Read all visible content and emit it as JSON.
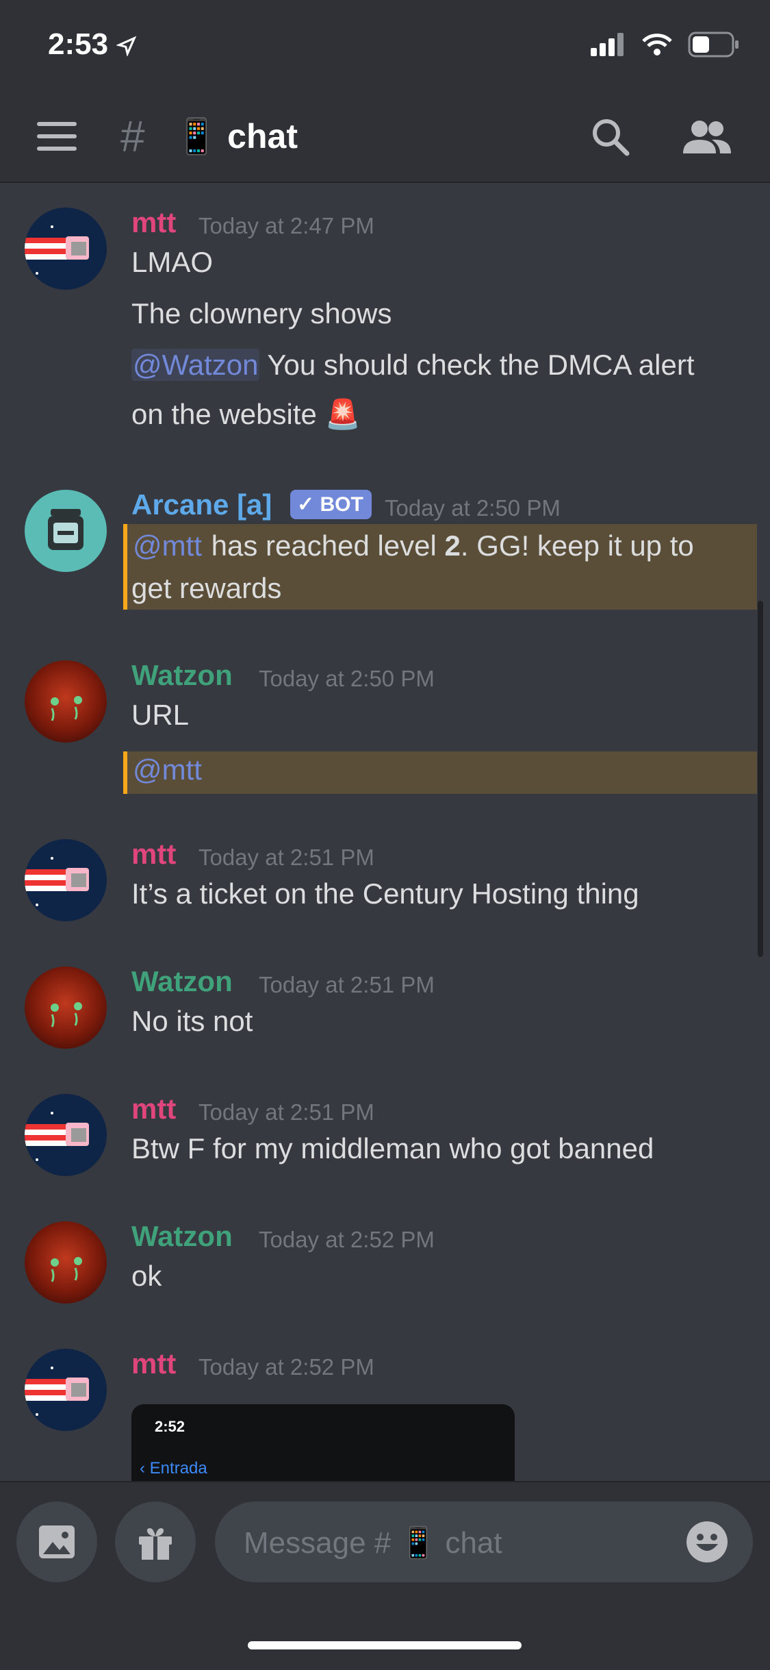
{
  "status": {
    "time": "2:53"
  },
  "header": {
    "hash": "#",
    "channel_emoji": "📱",
    "channel_name": "chat"
  },
  "messages": [
    {
      "user": "mtt",
      "time": "Today at 2:47 PM",
      "lines": [
        "LMAO",
        "The clownery shows"
      ],
      "mention": "@Watzon",
      "mention_rest": " You should check the DMCA alert",
      "wrap": "on the website 🚨"
    },
    {
      "user": "Arcane [a]",
      "bot_label": "BOT",
      "time": "Today at 2:50 PM",
      "mention": "@mtt",
      "text_a": " has reached level ",
      "level": "2",
      "text_b": ". GG! keep it up to",
      "wrap": "get rewards"
    },
    {
      "user": "Watzon",
      "time": "Today at 2:50 PM",
      "text": "URL",
      "mention": "@mtt"
    },
    {
      "user": "mtt",
      "time": "Today at 2:51 PM",
      "text": "It’s a ticket on the Century Hosting thing"
    },
    {
      "user": "Watzon",
      "time": "Today at 2:51 PM",
      "text": "No its not"
    },
    {
      "user": "mtt",
      "time": "Today at 2:51 PM",
      "text": "Btw F for my middleman who got banned"
    },
    {
      "user": "Watzon",
      "time": "Today at 2:52 PM",
      "text": "ok"
    },
    {
      "user": "mtt",
      "time": "Today at 2:52 PM"
    }
  ],
  "embed": {
    "time": "2:52",
    "back_label": "Entrada"
  },
  "composer": {
    "placeholder": "Message # 📱 chat"
  },
  "colors": {
    "background": "#36393f",
    "header": "#2f3136",
    "mention": "#7289da",
    "highlight": "#5b4e38"
  }
}
